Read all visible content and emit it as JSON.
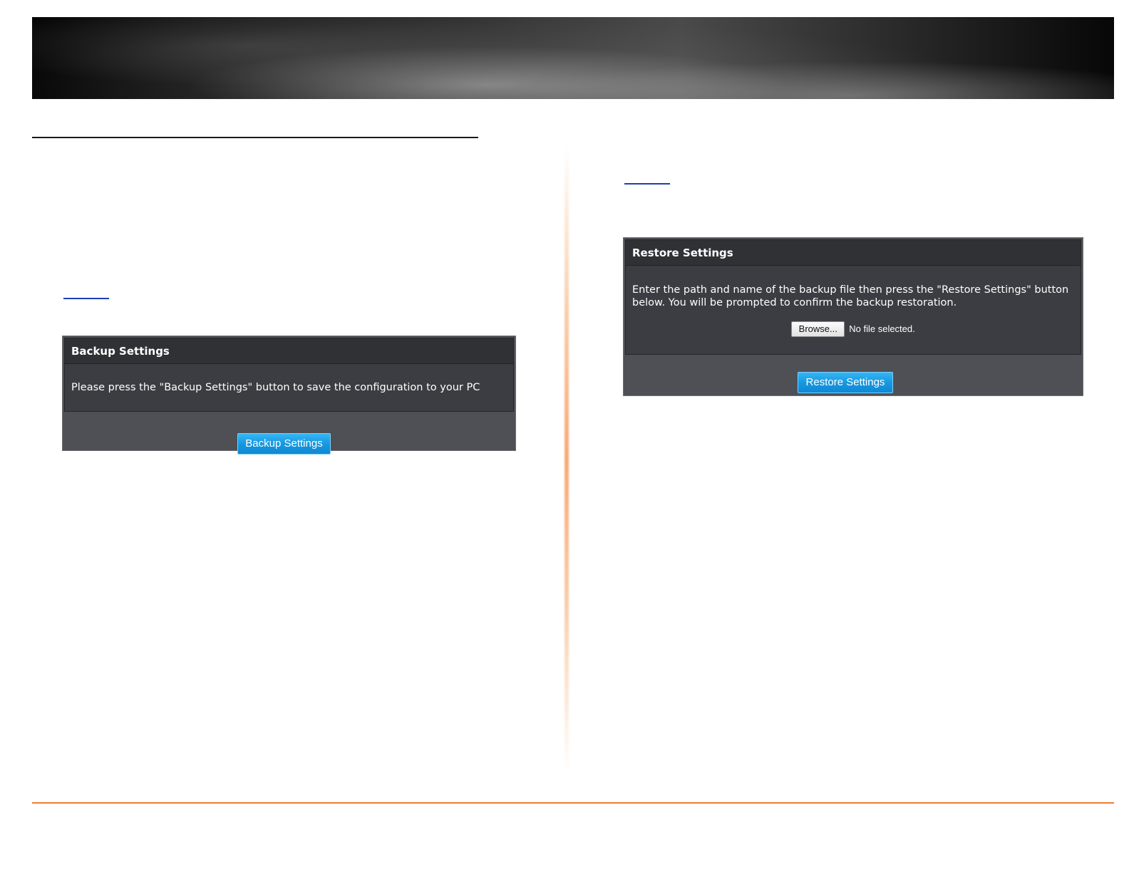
{
  "backup": {
    "panel_title": "Backup Settings",
    "description": "Please press the \"Backup Settings\" button to save the configuration to your PC",
    "button_label": "Backup Settings"
  },
  "restore": {
    "panel_title": "Restore Settings",
    "description": "Enter the path and name of the backup file then press the \"Restore Settings\" button below. You will be prompted to confirm the backup restoration.",
    "browse_label": "Browse...",
    "file_status": "No file selected.",
    "button_label": "Restore Settings"
  },
  "colors": {
    "accent_blue": "#1798e0",
    "panel_bg": "#3c3d42",
    "footer_rule": "#f07a36",
    "link_underline": "#1f3fb5"
  }
}
